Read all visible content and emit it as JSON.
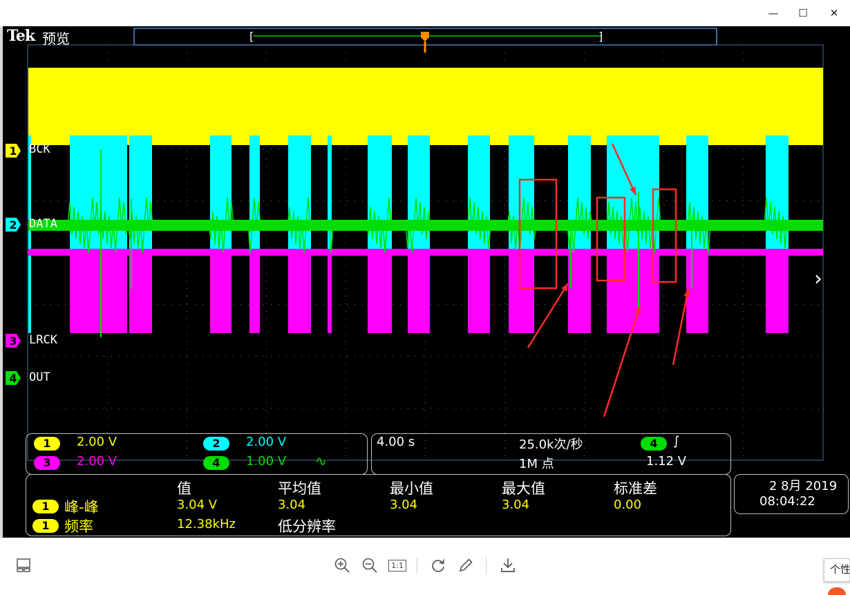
{
  "window": {
    "minimize_icon": "minimize-icon",
    "maximize_icon": "maximize-icon",
    "close_icon": "close-icon",
    "minimize_glyph": "—",
    "maximize_glyph": "☐",
    "close_glyph": "✕"
  },
  "scope": {
    "brand": "Tek",
    "mode": "预览",
    "trigger_marker": "T",
    "channels": [
      {
        "num": "1",
        "name": "BCK",
        "color": "#ffff00"
      },
      {
        "num": "2",
        "name": "DATA",
        "color": "#00ffff"
      },
      {
        "num": "3",
        "name": "LRCK",
        "color": "#ff00ff"
      },
      {
        "num": "4",
        "name": "OUT",
        "color": "#00dd00"
      }
    ],
    "next_icon": "chevron-right-icon",
    "next_glyph": "›"
  },
  "vertical_settings": {
    "ch1": {
      "num": "1",
      "value": "2.00 V",
      "color": "#ffff00"
    },
    "ch2": {
      "num": "2",
      "value": "2.00 V",
      "color": "#00ffff"
    },
    "ch3": {
      "num": "3",
      "value": "2.00 V",
      "color": "#ff00ff"
    },
    "ch4": {
      "num": "4",
      "value": "1.00 V",
      "color": "#00dd00",
      "coupling": "∿"
    }
  },
  "horizontal_settings": {
    "timebase": "4.00 s",
    "sample_rate": "25.0k次/秒",
    "record_length": "1M 点",
    "trigger_source": "4",
    "trigger_slope": "∫",
    "trigger_level": "1.12 V"
  },
  "measurements": {
    "headers": [
      "值",
      "平均值",
      "最小值",
      "最大值",
      "标准差"
    ],
    "rows": [
      {
        "source": "1",
        "name": "峰-峰",
        "value": "3.04 V",
        "mean": "3.04",
        "min": "3.04",
        "max": "3.04",
        "std": "0.00"
      },
      {
        "source": "1",
        "name": "频率",
        "value": "12.38kHz",
        "note": "低分辨率"
      }
    ]
  },
  "datetime": {
    "date": "2 8月 2019",
    "time": "08:04:22"
  },
  "toolbar": {
    "layout_icon": "layout-icon",
    "zoom_in_icon": "zoom-in-icon",
    "zoom_out_icon": "zoom-out-icon",
    "actual_size_label": "1:1",
    "rotate_icon": "rotate-icon",
    "edit_icon": "pencil-icon",
    "download_icon": "download-icon"
  },
  "tooltip": {
    "text": "个性"
  }
}
